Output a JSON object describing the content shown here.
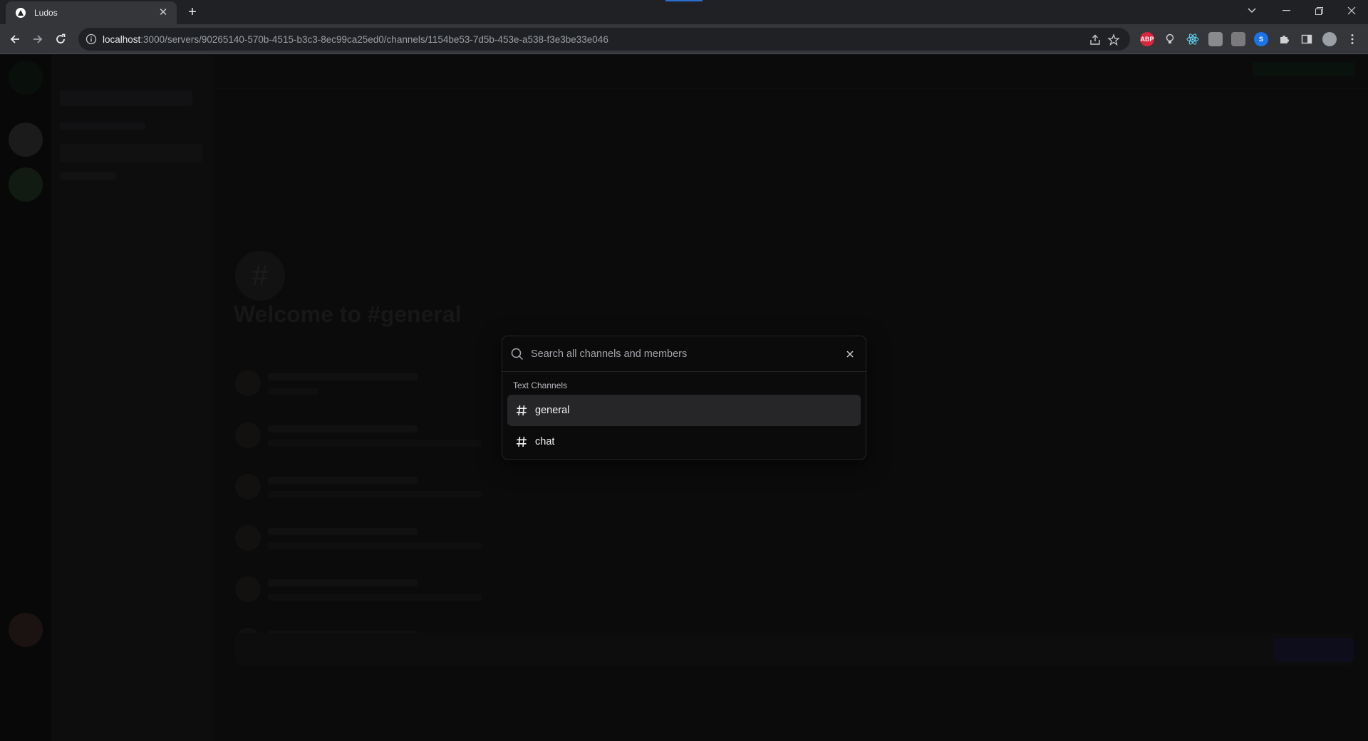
{
  "browser": {
    "tab_title": "Ludos",
    "url_host": "localhost",
    "url_path": ":3000/servers/90265140-570b-4515-b3c3-8ec99ca25ed0/channels/1154be53-7d5b-453e-a538-f3e3be33e046",
    "extensions": [
      "adblock-icon",
      "lightbulb-icon",
      "react-devtools-icon",
      "extension-icon",
      "extension-icon",
      "shazam-icon",
      "puzzle-icon",
      "sidebar-icon",
      "profile-avatar"
    ]
  },
  "page": {
    "welcome_title": "Welcome to #general"
  },
  "search_modal": {
    "placeholder": "Search all channels and members",
    "group_heading": "Text Channels",
    "options": [
      {
        "label": "general",
        "selected": true
      },
      {
        "label": "chat",
        "selected": false
      }
    ]
  },
  "colors": {
    "modal_bg": "#0b0b0c",
    "selected_bg": "#262628",
    "chrome_dark": "#202124",
    "chrome_mid": "#35363a"
  }
}
